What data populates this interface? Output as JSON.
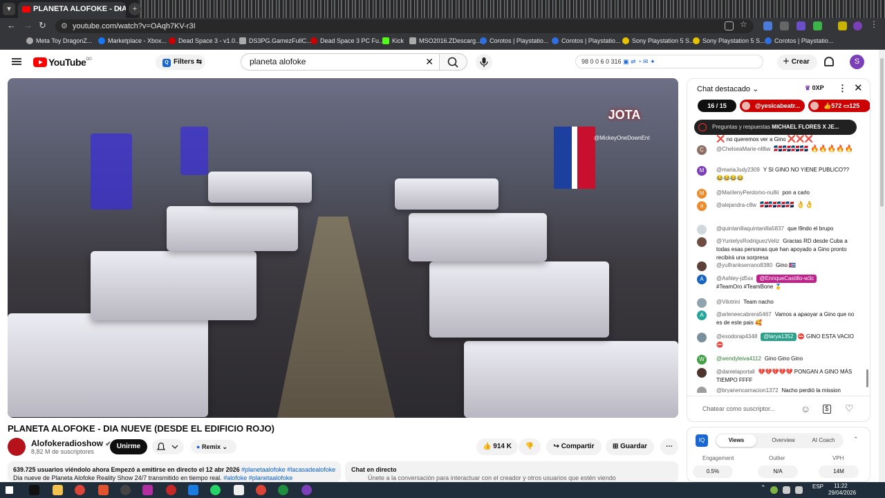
{
  "browser": {
    "tab_title": "PLANETA ALOFOKE - DIA N",
    "tab_close": "×",
    "url": "youtube.com/watch?v=OAqh7KV-r3I",
    "bookmarks": [
      "Meta Toy DragonZ...",
      "Marketplace - Xbox...",
      "Dead Space 3 - v1.0...",
      "DS3PG.GamezFullC...",
      "Dead Space 3 PC Fu...",
      "Kick",
      "MSO2016.ZDescarg...",
      "Corotos | Playstatio...",
      "Corotos | Playstatio...",
      "Sony Playstation 5 S...",
      "Sony Playstation 5 S...",
      "Corotos | Playstatio..."
    ]
  },
  "yt": {
    "logo": "YouTube",
    "logo_country": "DO",
    "filters": "Filters",
    "search_value": "planeta alofoke",
    "stats": "98  0  0  6  0  316",
    "crear": "Crear",
    "avatar": "S"
  },
  "video": {
    "overlay_brand": "JOTA",
    "overlay_handle": "@MickeyOneDownEnt",
    "title": "PLANETA ALOFOKE - DIA NUEVE (DESDE EL EDIFICIO ROJO)",
    "channel": "Alofokeradioshow",
    "subscribers": "8,82 M de suscriptores",
    "join": "Unirme",
    "remix": "Remix",
    "likes": "914 K",
    "share": "Compartir",
    "save": "Guardar",
    "desc_line1_bold": "639.725 usuarios viéndolo ahora  Empezó a emitirse en directo el 12 abr 2026",
    "desc_line1_tags": "#planetaalofoke #lacasadealofoke",
    "desc_line2": "Dia nueve de Planeta Alofoke Reality Show 24/7 transmitido en tiempo real.",
    "desc_line2_tags": "#alofoke #planetaalofoke",
    "livechat_title": "Chat en directo",
    "livechat_sub": "Únete a la conversación para interactuar con el creador y otros usuarios que estén viendo"
  },
  "chat": {
    "header": "Chat destacado",
    "xp": "0XP",
    "pager": "16 / 15",
    "pinned_user": "@yesicabeatr...",
    "pinned_likes": "572",
    "pinned_comments": "125",
    "qa_label": "Preguntas y respuestas",
    "qa_value": "MICHAEL FLORES X JE...",
    "input_placeholder": "Chatear como suscriptor...",
    "messages": [
      {
        "author": "",
        "text": "no queremos ver a Gino",
        "avatar": "",
        "color": "#ffffff"
      },
      {
        "author": "@ChelseaMarie-nl8iw",
        "text": "🇩🇴🇩🇴🇩🇴🇩🇴 🔥🔥🔥🔥🔥",
        "avatar": "C",
        "color": "#8d6e63"
      },
      {
        "author": "@mariaJudy2309",
        "text": "Y SI GINO NO YIENE PUBLICO?? 😂😂😂😂",
        "avatar": "M",
        "color": "#7b3fb8"
      },
      {
        "author": "@MarilenyPerdomo-nu8ii",
        "text": "pon a carlo",
        "avatar": "M",
        "color": "#ef8a2a"
      },
      {
        "author": "@alejandra-c8w",
        "text": "🇩🇴🇩🇴🇩🇴🇩🇴 👌👌",
        "avatar": "a",
        "color": "#ef8a2a"
      },
      {
        "author": "@quintanillaquintanilla5837",
        "text": "que l9ndo el brupo",
        "avatar": "",
        "color": "#cfd8dc"
      },
      {
        "author": "@YunielysRodriguezVeliz",
        "text": "Gracias RD desde Cuba a todas esas personas que han apoyado a Gino pronto recibirá una sorpresa",
        "avatar": "",
        "color": "#6d4c41"
      },
      {
        "author": "@yulfrankserrano8380",
        "text": "Gino 🇨🇺",
        "avatar": "",
        "color": "#5d4037"
      },
      {
        "author": "@Ashley-jd5sx",
        "mention": "@EnriqueCastillo-w3c",
        "text": "#TeamOro #TeamBone 🥇",
        "avatar": "A",
        "color": "#1565c0"
      },
      {
        "author": "@Vilotrini",
        "text": "Team nacho",
        "avatar": "",
        "color": "#90a4ae"
      },
      {
        "author": "@arleneecabrera5467",
        "text": "Vamos a apaoyar a Gino que no es de este pais 🥰",
        "avatar": "A",
        "color": "#26a69a"
      },
      {
        "author": "@exodorap4348",
        "mention": "@larya1352",
        "text": "⛔ GINO ESTA VACIO ⛔",
        "avatar": "",
        "color": "#78909c"
      },
      {
        "author": "@wendyleiva4112",
        "text": "Gino Gino Gino",
        "avatar": "W",
        "color": "#43a047"
      },
      {
        "author": "@danielaportall",
        "text": "💔💔💔💔💔 PONGAN A GINO MÁS TIEMPO FFFF",
        "avatar": "",
        "color": "#4e342e"
      },
      {
        "author": "@bryanencarnacion1372",
        "text": "Nacho perdió la mission",
        "avatar": "",
        "color": "#9e9e9e"
      }
    ]
  },
  "stats_panel": {
    "tabs": [
      "Views",
      "Overview",
      "AI Coach"
    ],
    "metrics": [
      {
        "label": "Engagement",
        "value": "0.5%"
      },
      {
        "label": "Outlier",
        "value": "N/A"
      },
      {
        "label": "VPH",
        "value": "14M"
      }
    ]
  },
  "taskbar": {
    "language": "ESP",
    "time": "11:22",
    "date": "29/04/2026"
  }
}
